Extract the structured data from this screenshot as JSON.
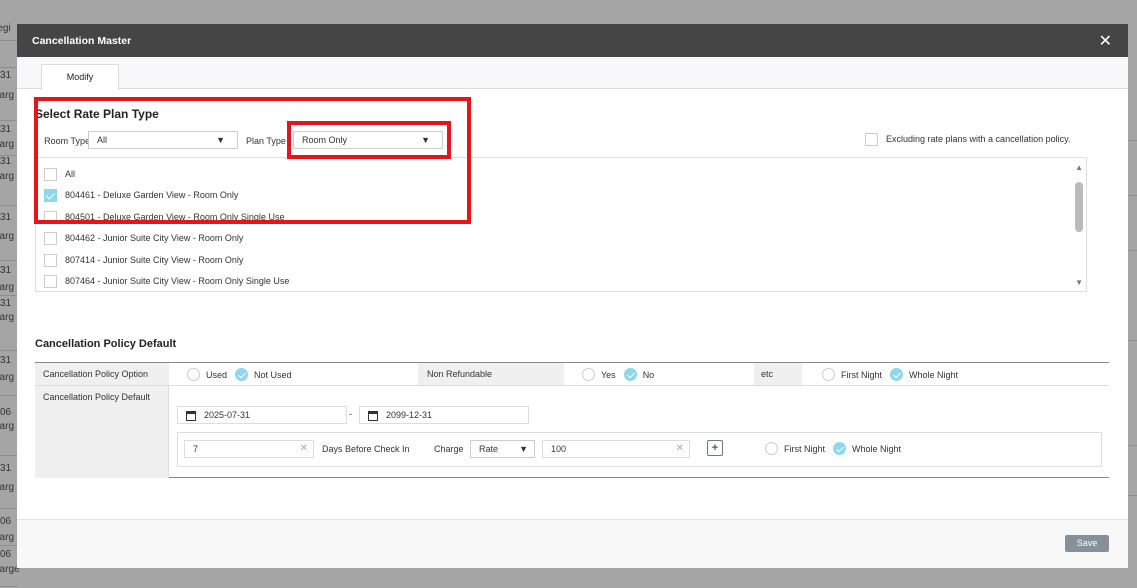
{
  "background_fragments": [
    "regi",
    "31",
    "harg",
    "31",
    "harg",
    "31",
    "harg",
    "31",
    "harg",
    "31",
    "harg",
    "31",
    "harg",
    "31",
    "harg",
    "06",
    "harg",
    "31",
    "harg",
    "06",
    "harg",
    "06",
    "harge"
  ],
  "modal": {
    "title": "Cancellation Master",
    "close_icon": "close-icon",
    "tab": "Modify"
  },
  "rate_plan": {
    "heading": "Select Rate Plan Type",
    "room_type_label": "Room Type",
    "room_type_value": "All",
    "plan_type_label": "Plan Type",
    "plan_type_value": "Room Only",
    "exclude_label": "Excluding rate plans with a cancellation policy.",
    "items": [
      {
        "label": "All",
        "checked": false
      },
      {
        "label": "804461 - Deluxe Garden View - Room Only",
        "checked": true
      },
      {
        "label": "804501 - Deluxe Garden View - Room Only Single Use",
        "checked": false
      },
      {
        "label": "804462 - Junior Suite City View - Room Only",
        "checked": false
      },
      {
        "label": "807414 - Junior Suite City View - Room Only",
        "checked": false
      },
      {
        "label": "807464 - Junior Suite City View - Room Only Single Use",
        "checked": false
      }
    ]
  },
  "policy": {
    "heading": "Cancellation Policy Default",
    "option_label": "Cancellation Policy Option",
    "used": "Used",
    "not_used": "Not Used",
    "non_refundable_label": "Non Refundable",
    "yes": "Yes",
    "no": "No",
    "etc_label": "etc",
    "first_night": "First Night",
    "whole_night": "Whole Night",
    "default_label": "Cancellation Policy Default",
    "date_from": "2025-07-31",
    "date_sep": "-",
    "date_to": "2099-12-31",
    "days": "7",
    "days_label": "Days Before Check In",
    "charge_label": "Charge",
    "charge_type": "Rate",
    "charge_value": "100",
    "add": "+",
    "rule_first_night": "First Night",
    "rule_whole_night": "Whole Night"
  },
  "footer": {
    "save": "Save"
  }
}
